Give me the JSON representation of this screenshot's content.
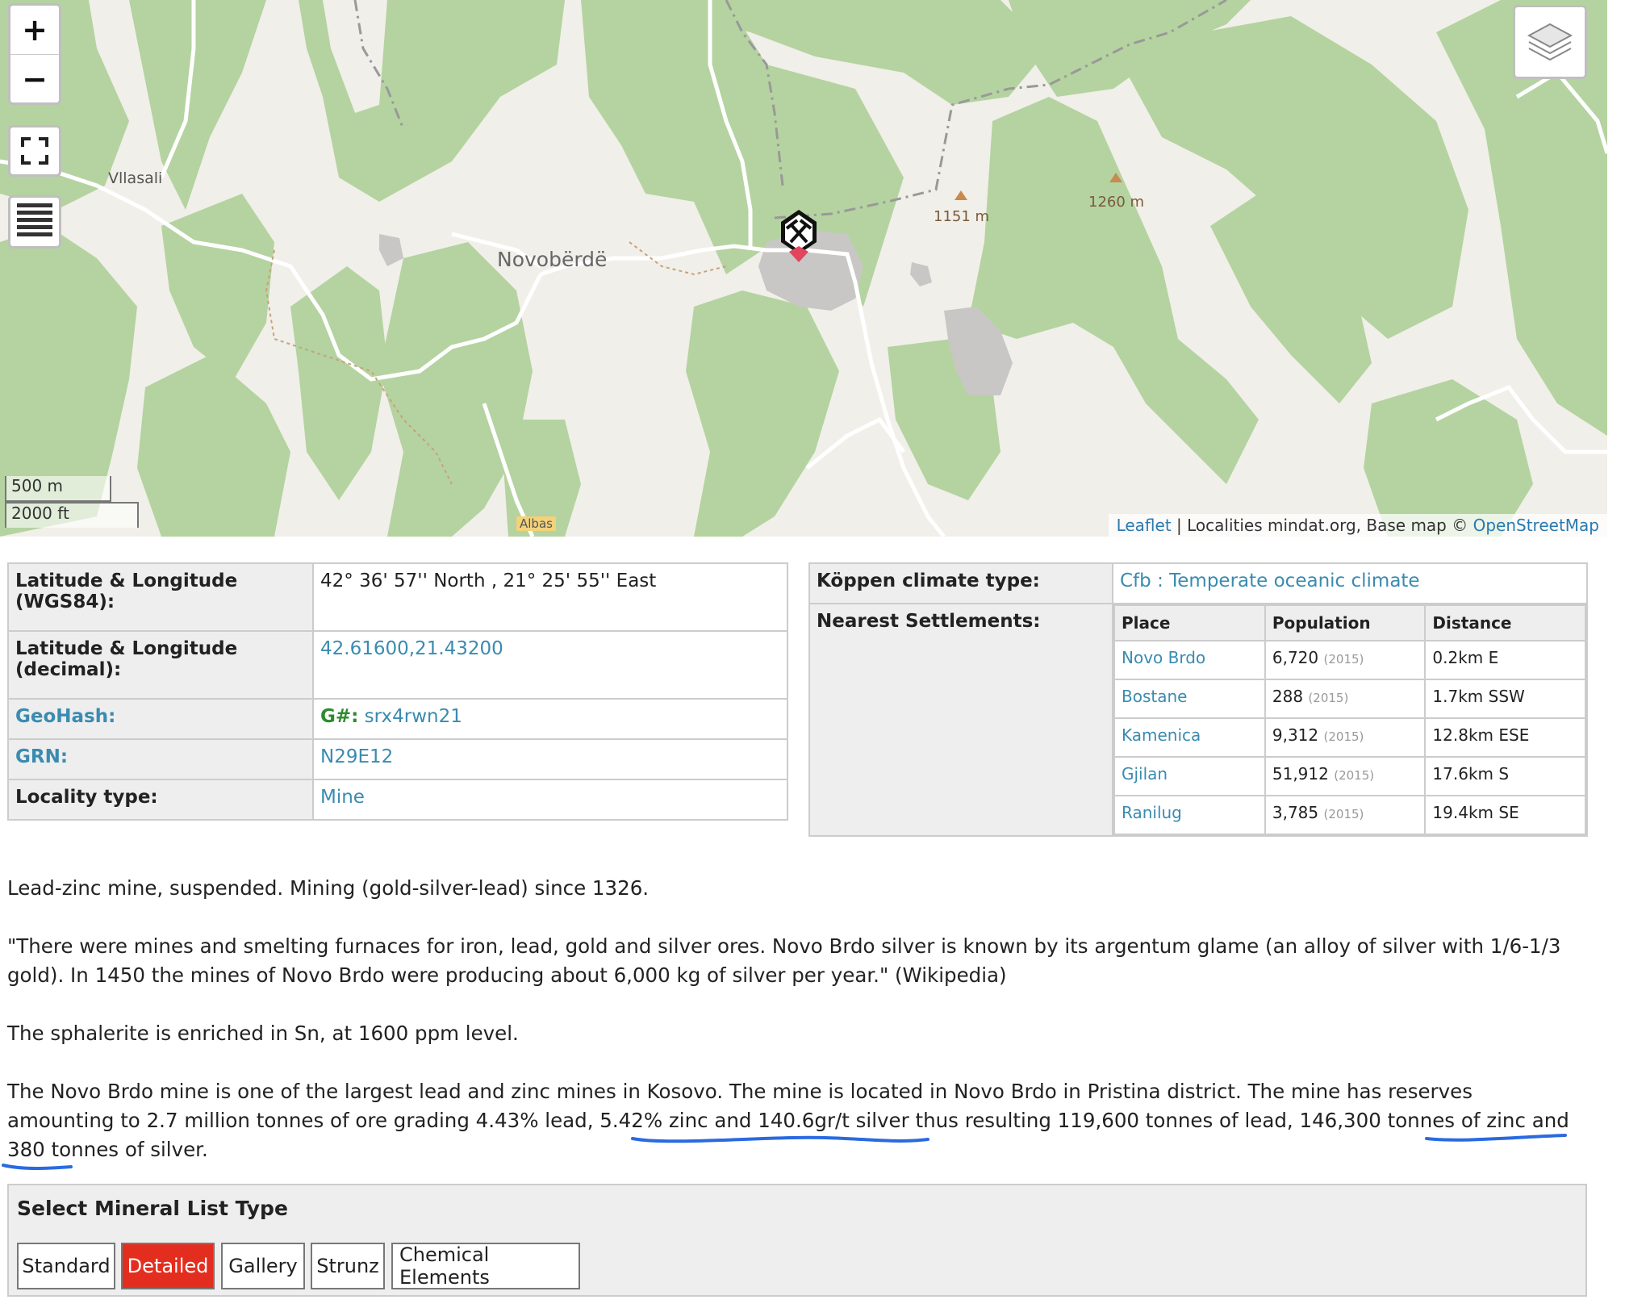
{
  "map": {
    "zoom_in": "+",
    "zoom_out": "−",
    "labels": {
      "vllasali": "Vllasali",
      "novoberde": "Novobërdë",
      "peak1": "1151 m",
      "peak2": "1260 m",
      "road": "Albas"
    },
    "scale_m": "500 m",
    "scale_ft": "2000 ft",
    "attribution": {
      "leaflet": "Leaflet",
      "sep": " | Localities mindat.org, Base map © ",
      "osm": "OpenStreetMap"
    },
    "icons": [
      "fullscreen-icon",
      "list-icon",
      "layers-icon",
      "mine-marker-icon"
    ]
  },
  "locality": {
    "latlon_label": "Latitude & Longitude (WGS84):",
    "latlon_value": "42° 36' 57'' North , 21° 25' 55'' East",
    "latlon_dec_label": "Latitude & Longitude (decimal):",
    "latlon_dec_value": "42.61600,21.43200",
    "geohash_label": "GeoHash:",
    "geohash_prefix": "G#:",
    "geohash_value": "srx4rwn21",
    "grn_label": "GRN:",
    "grn_value": "N29E12",
    "type_label": "Locality type:",
    "type_value": "Mine"
  },
  "climate": {
    "label": "Köppen climate type:",
    "value": "Cfb : Temperate oceanic climate",
    "settlements_label": "Nearest Settlements:",
    "headers": [
      "Place",
      "Population",
      "Distance"
    ],
    "rows": [
      {
        "place": "Novo Brdo",
        "pop": "6,720",
        "year": "(2015)",
        "dist": "0.2km E"
      },
      {
        "place": "Bostane",
        "pop": "288",
        "year": "(2015)",
        "dist": "1.7km SSW"
      },
      {
        "place": "Kamenica",
        "pop": "9,312",
        "year": "(2015)",
        "dist": "12.8km ESE"
      },
      {
        "place": "Gjilan",
        "pop": "51,912",
        "year": "(2015)",
        "dist": "17.6km S"
      },
      {
        "place": "Ranilug",
        "pop": "3,785",
        "year": "(2015)",
        "dist": "19.4km SE"
      }
    ]
  },
  "description": {
    "p1": "Lead-zinc mine, suspended. Mining (gold-silver-lead) since 1326.",
    "p2": "\"There were mines and smelting furnaces for iron, lead, gold and silver ores. Novo Brdo silver is known by its argentum glame (an alloy of silver with 1/6-1/3 gold). In 1450 the mines of Novo Brdo were producing about 6,000 kg of silver per year.\" (Wikipedia)",
    "p3": "The sphalerite is enriched in Sn, at 1600 ppm level.",
    "p4": "The Novo Brdo mine is one of the largest lead and zinc mines in Kosovo. The mine is located in Novo Brdo in Pristina district. The mine has reserves amounting to 2.7 million tonnes of ore grading 4.43% lead, 5.42% zinc and 140.6gr/t silver thus resulting 119,600 tonnes of lead, 146,300 tonnes of zinc and 380 tonnes of silver."
  },
  "mineral_list": {
    "title": "Select Mineral List Type",
    "buttons": [
      "Standard",
      "Detailed",
      "Gallery",
      "Strunz",
      "Chemical Elements"
    ],
    "active": "Detailed"
  },
  "colors": {
    "forest": "#b4d3a0",
    "land": "#f1efe9",
    "link": "#3a8bb0",
    "active_button": "#e32e1f",
    "annotation": "#2a6ae0"
  }
}
